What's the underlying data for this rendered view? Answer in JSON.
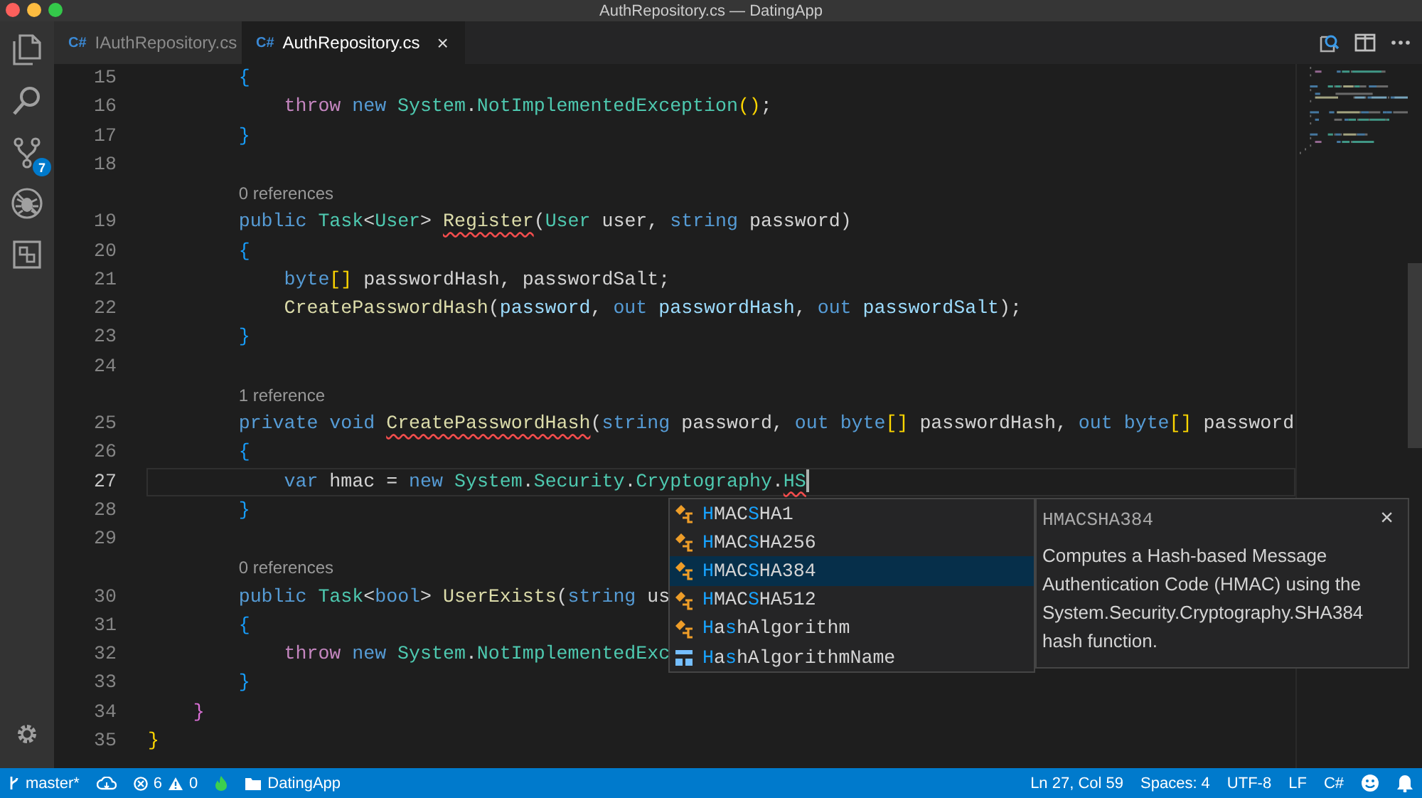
{
  "window": {
    "title": "AuthRepository.cs — DatingApp"
  },
  "activity_bar": {
    "items": [
      {
        "kind": "files"
      },
      {
        "kind": "search"
      },
      {
        "kind": "scm",
        "badge": "7"
      },
      {
        "kind": "debug"
      },
      {
        "kind": "extensions"
      }
    ]
  },
  "tabs": [
    {
      "lang": "C#",
      "label": "IAuthRepository.cs",
      "selected": false
    },
    {
      "lang": "C#",
      "label": "AuthRepository.cs",
      "selected": true,
      "close": "×"
    }
  ],
  "editor": {
    "lines": [
      {
        "num": "15",
        "tokens": [
          {
            "t": "        {",
            "kind": "b3"
          }
        ]
      },
      {
        "num": "16",
        "tokens": [
          {
            "t": "            throw",
            "kind": "ctrl"
          },
          {
            "t": " new",
            "kind": "kw"
          },
          {
            "t": " System",
            "kind": "type"
          },
          {
            "t": ".",
            "kind": "plain"
          },
          {
            "t": "NotImplementedException",
            "kind": "type"
          },
          {
            "t": "()",
            "kind": "b1"
          },
          {
            "t": ";",
            "kind": "plain"
          }
        ]
      },
      {
        "num": "17",
        "tokens": [
          {
            "t": "        }",
            "kind": "b3"
          }
        ]
      },
      {
        "num": "18"
      },
      {
        "lens": "0 references"
      },
      {
        "num": "19",
        "tokens": [
          {
            "t": "        public",
            "kind": "kw"
          },
          {
            "t": " Task",
            "kind": "type"
          },
          {
            "t": "<",
            "kind": "plain"
          },
          {
            "t": "User",
            "kind": "type"
          },
          {
            "t": "> ",
            "kind": "plain"
          },
          {
            "t": "Register",
            "kind": "fn",
            "error": true
          },
          {
            "t": "(",
            "kind": "plain"
          },
          {
            "t": "User",
            "kind": "type"
          },
          {
            "t": " user, ",
            "kind": "plain"
          },
          {
            "t": "string",
            "kind": "kw"
          },
          {
            "t": " password)",
            "kind": "plain"
          }
        ]
      },
      {
        "num": "20",
        "tokens": [
          {
            "t": "        {",
            "kind": "b3"
          }
        ]
      },
      {
        "num": "21",
        "tokens": [
          {
            "t": "            byte",
            "kind": "kw"
          },
          {
            "t": "[]",
            "kind": "b1"
          },
          {
            "t": " passwordHash, passwordSalt;",
            "kind": "plain"
          }
        ]
      },
      {
        "num": "22",
        "tokens": [
          {
            "t": "            CreatePasswordHash",
            "kind": "fn"
          },
          {
            "t": "(",
            "kind": "plain"
          },
          {
            "t": "password",
            "kind": "var"
          },
          {
            "t": ", ",
            "kind": "plain"
          },
          {
            "t": "out",
            "kind": "kw"
          },
          {
            "t": " passwordHash",
            "kind": "var"
          },
          {
            "t": ", ",
            "kind": "plain"
          },
          {
            "t": "out",
            "kind": "kw"
          },
          {
            "t": " passwordSalt",
            "kind": "var"
          },
          {
            "t": ");",
            "kind": "plain"
          }
        ]
      },
      {
        "num": "23",
        "tokens": [
          {
            "t": "        }",
            "kind": "b3"
          }
        ]
      },
      {
        "num": "24"
      },
      {
        "lens": "1 reference"
      },
      {
        "num": "25",
        "tokens": [
          {
            "t": "        private",
            "kind": "kw"
          },
          {
            "t": " void ",
            "kind": "kw"
          },
          {
            "t": "CreatePasswordHash",
            "kind": "fn",
            "error": true
          },
          {
            "t": "(",
            "kind": "plain"
          },
          {
            "t": "string",
            "kind": "kw"
          },
          {
            "t": " password, ",
            "kind": "plain"
          },
          {
            "t": "out",
            "kind": "kw"
          },
          {
            "t": " byte",
            "kind": "kw"
          },
          {
            "t": "[]",
            "kind": "b1"
          },
          {
            "t": " passwordHash, ",
            "kind": "plain"
          },
          {
            "t": "out",
            "kind": "kw"
          },
          {
            "t": " byte",
            "kind": "kw"
          },
          {
            "t": "[]",
            "kind": "b1"
          },
          {
            "t": " password",
            "kind": "plain"
          }
        ]
      },
      {
        "num": "26",
        "tokens": [
          {
            "t": "        {",
            "kind": "b3"
          }
        ]
      },
      {
        "num": "27",
        "current": true,
        "tokens": [
          {
            "t": "            var",
            "kind": "kw"
          },
          {
            "t": " hmac = ",
            "kind": "plain"
          },
          {
            "t": "new",
            "kind": "kw"
          },
          {
            "t": " System",
            "kind": "type"
          },
          {
            "t": ".",
            "kind": "plain"
          },
          {
            "t": "Security",
            "kind": "type"
          },
          {
            "t": ".",
            "kind": "plain"
          },
          {
            "t": "Cryptography",
            "kind": "type"
          },
          {
            "t": ".",
            "kind": "plain"
          },
          {
            "t": "HS",
            "kind": "type",
            "error": true
          }
        ]
      },
      {
        "num": "28",
        "tokens": [
          {
            "t": "        }",
            "kind": "b3"
          }
        ]
      },
      {
        "num": "29"
      },
      {
        "lens": "0 references"
      },
      {
        "num": "30",
        "tokens": [
          {
            "t": "        public",
            "kind": "kw"
          },
          {
            "t": " Task",
            "kind": "type"
          },
          {
            "t": "<",
            "kind": "plain"
          },
          {
            "t": "bool",
            "kind": "kw"
          },
          {
            "t": "> ",
            "kind": "plain"
          },
          {
            "t": "UserExists",
            "kind": "fn"
          },
          {
            "t": "(",
            "kind": "plain"
          },
          {
            "t": "string",
            "kind": "kw"
          },
          {
            "t": " us",
            "kind": "plain"
          }
        ]
      },
      {
        "num": "31",
        "tokens": [
          {
            "t": "        {",
            "kind": "b3"
          }
        ]
      },
      {
        "num": "32",
        "tokens": [
          {
            "t": "            throw",
            "kind": "ctrl"
          },
          {
            "t": " new",
            "kind": "kw"
          },
          {
            "t": " System",
            "kind": "type"
          },
          {
            "t": ".",
            "kind": "plain"
          },
          {
            "t": "NotImplementedExc",
            "kind": "type"
          }
        ]
      },
      {
        "num": "33",
        "tokens": [
          {
            "t": "        }",
            "kind": "b3"
          }
        ]
      },
      {
        "num": "34",
        "tokens": [
          {
            "t": "    }",
            "kind": "b2"
          }
        ]
      },
      {
        "num": "35",
        "tokens": [
          {
            "t": "}",
            "kind": "b1"
          }
        ]
      }
    ]
  },
  "suggestions": {
    "items": [
      {
        "kind": "class",
        "selected": false,
        "parts": [
          {
            "t": "H",
            "match": true
          },
          {
            "t": "MAC",
            "match": false
          },
          {
            "t": "S",
            "match": true
          },
          {
            "t": "HA1",
            "match": false
          }
        ]
      },
      {
        "kind": "class",
        "selected": false,
        "parts": [
          {
            "t": "H",
            "match": true
          },
          {
            "t": "MAC",
            "match": false
          },
          {
            "t": "S",
            "match": true
          },
          {
            "t": "HA256",
            "match": false
          }
        ]
      },
      {
        "kind": "class",
        "selected": true,
        "parts": [
          {
            "t": "H",
            "match": true
          },
          {
            "t": "MAC",
            "match": false
          },
          {
            "t": "S",
            "match": true
          },
          {
            "t": "HA384",
            "match": false
          }
        ]
      },
      {
        "kind": "class",
        "selected": false,
        "parts": [
          {
            "t": "H",
            "match": true
          },
          {
            "t": "MAC",
            "match": false
          },
          {
            "t": "S",
            "match": true
          },
          {
            "t": "HA512",
            "match": false
          }
        ]
      },
      {
        "kind": "class",
        "selected": false,
        "parts": [
          {
            "t": "H",
            "match": true
          },
          {
            "t": "a",
            "match": false
          },
          {
            "t": "s",
            "match": true
          },
          {
            "t": "hAlgorithm",
            "match": false
          }
        ]
      },
      {
        "kind": "enum",
        "selected": false,
        "parts": [
          {
            "t": "H",
            "match": true
          },
          {
            "t": "a",
            "match": false
          },
          {
            "t": "s",
            "match": true
          },
          {
            "t": "hAlgorithmName",
            "match": false
          }
        ]
      }
    ],
    "detail": {
      "title": "HMACSHA384",
      "close": "×",
      "description": "Computes a Hash-based Message Authentication Code (HMAC) using the System.Security.Cryptography.SHA384 hash function."
    }
  },
  "status_bar": {
    "branch": "master*",
    "errors": "6",
    "warnings": "0",
    "folder": "DatingApp",
    "position": "Ln 27, Col 59",
    "indent": "Spaces: 4",
    "encoding": "UTF-8",
    "eol": "LF",
    "language": "C#"
  }
}
